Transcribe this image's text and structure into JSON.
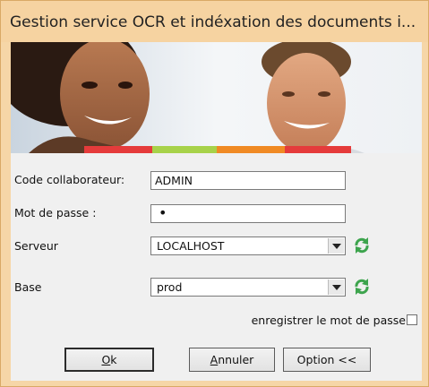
{
  "window": {
    "title": "Gestion service OCR et indéxation des documents i..."
  },
  "form": {
    "user_label": "Code collaborateur:",
    "user_value": "ADMIN",
    "password_label": "Mot de passe :",
    "password_value": "•",
    "server_label": "Serveur",
    "server_value": "LOCALHOST",
    "base_label": "Base",
    "base_value": "prod",
    "remember_label": "enregistrer le mot de passe"
  },
  "buttons": {
    "ok_underlined": "O",
    "ok_rest": "k",
    "cancel_underlined": "A",
    "cancel_rest": "nnuler",
    "option_label": "Option <<"
  },
  "colors": {
    "stripe": [
      "#e53b3b",
      "#a7d24a",
      "#f08a24",
      "#e53b3b"
    ],
    "refresh_icon": "#3da44d"
  }
}
